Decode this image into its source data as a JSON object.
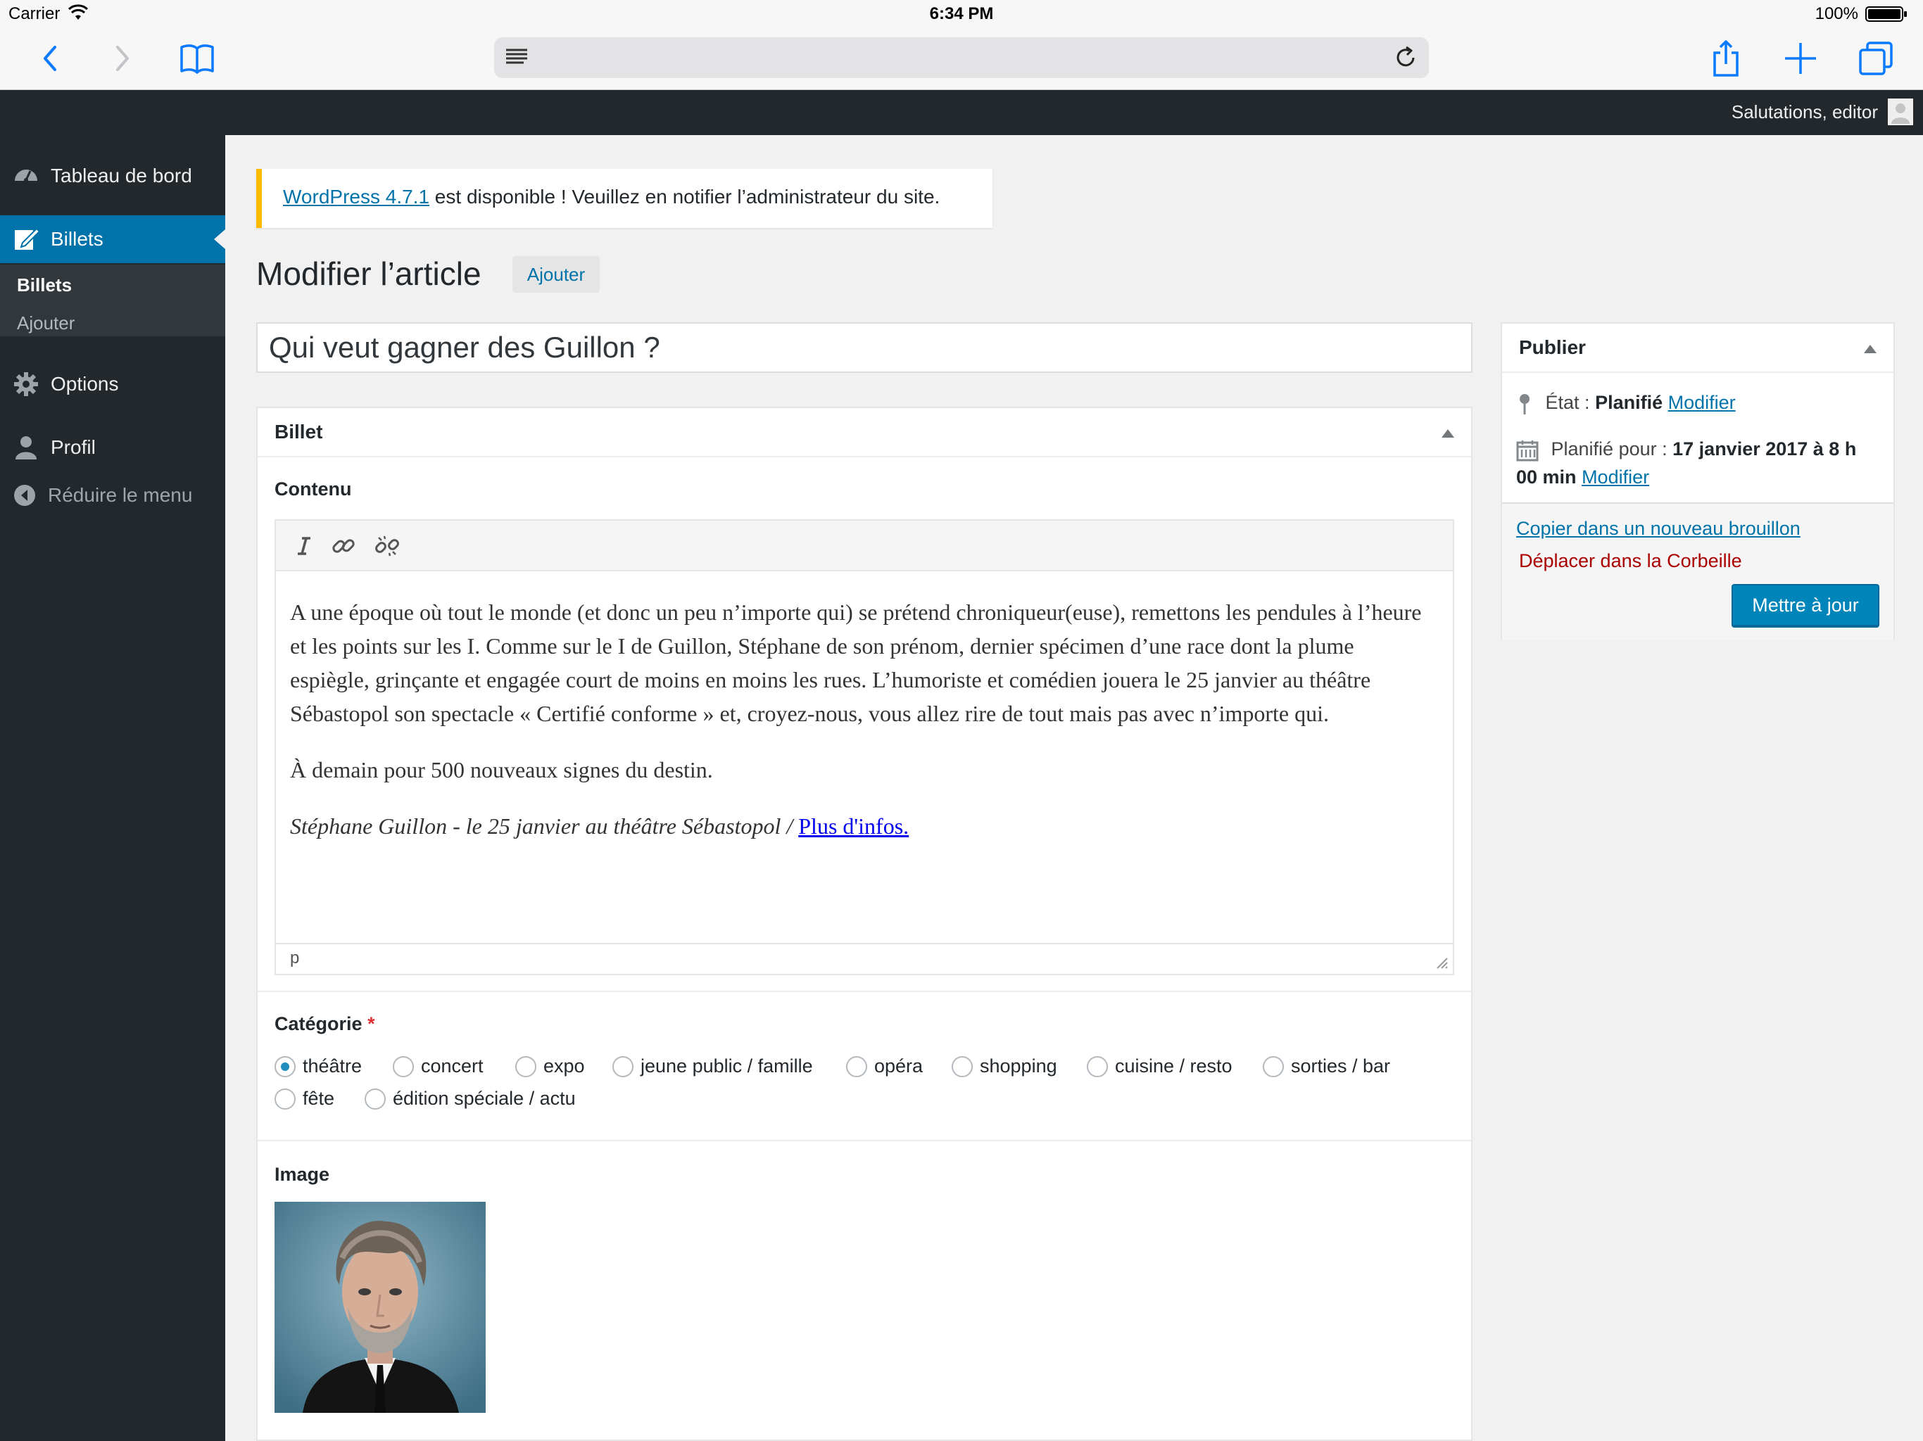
{
  "statusbar": {
    "carrier": "Carrier",
    "time": "6:34 PM",
    "battery": "100%"
  },
  "adminbar": {
    "greeting": "Salutations, editor"
  },
  "sidebar": {
    "items": [
      {
        "label": "Tableau de bord",
        "icon": "dashboard-icon"
      },
      {
        "label": "Billets",
        "icon": "posts-icon"
      },
      {
        "label": "Options",
        "icon": "gear-icon"
      },
      {
        "label": "Profil",
        "icon": "user-icon"
      },
      {
        "label": "Réduire le menu",
        "icon": "collapse-icon"
      }
    ],
    "submenu": [
      "Billets",
      "Ajouter"
    ]
  },
  "notice": {
    "link": "WordPress 4.7.1",
    "text": " est disponible ! Veuillez en notifier l’administrateur du site."
  },
  "page": {
    "title": "Modifier l’article",
    "add_new": "Ajouter"
  },
  "post": {
    "title": "Qui veut gagner des Guillon ?",
    "box_title": "Billet",
    "content_label": "Contenu",
    "paragraphs": [
      "A une époque où tout le monde (et donc un peu n’importe qui) se prétend chroniqueur(euse), remettons les pendules à l’heure et les points sur les I. Comme sur le I de Guillon, Stéphane de son prénom, dernier spécimen d’une race dont la plume espiègle, grinçante et engagée court de moins en moins les rues. L’humoriste et comédien jouera le 25 janvier au théâtre Sébastopol son spectacle « Certifié conforme » et, croyez-nous, vous allez rire de tout mais pas avec n’importe qui.",
      "À demain pour 500 nouveaux signes du destin.",
      "Stéphane Guillon - le 25 janvier au théâtre Sébastopol / "
    ],
    "more_link": "Plus d'infos.",
    "status_path": "p",
    "category_label": "Catégorie",
    "required_mark": "*",
    "categories": [
      {
        "label": "théâtre",
        "checked": true
      },
      {
        "label": "concert",
        "checked": false
      },
      {
        "label": "expo",
        "checked": false
      },
      {
        "label": "jeune public / famille",
        "checked": false
      },
      {
        "label": "opéra",
        "checked": false
      },
      {
        "label": "shopping",
        "checked": false
      },
      {
        "label": "cuisine / resto",
        "checked": false
      },
      {
        "label": "sorties / bar",
        "checked": false
      },
      {
        "label": "fête",
        "checked": false
      },
      {
        "label": "édition spéciale / actu",
        "checked": false
      }
    ],
    "image_label": "Image"
  },
  "publish": {
    "title": "Publier",
    "status_label": "État :",
    "status_value": "Planifié",
    "status_edit": "Modifier",
    "schedule_label": "Planifié pour :",
    "schedule_value_1": "17 janvier 2017 à 8 h",
    "schedule_value_2": "00 min",
    "schedule_edit": "Modifier",
    "copy_draft": "Copier dans un nouveau brouillon",
    "trash": "Déplacer dans la Corbeille",
    "update": "Mettre à jour"
  },
  "colors": {
    "accent": "#0073aa",
    "sidebar_bg": "#23282d",
    "notice_border": "#ffb900",
    "primary_button": "#0085ba",
    "trash": "#aa0000"
  }
}
